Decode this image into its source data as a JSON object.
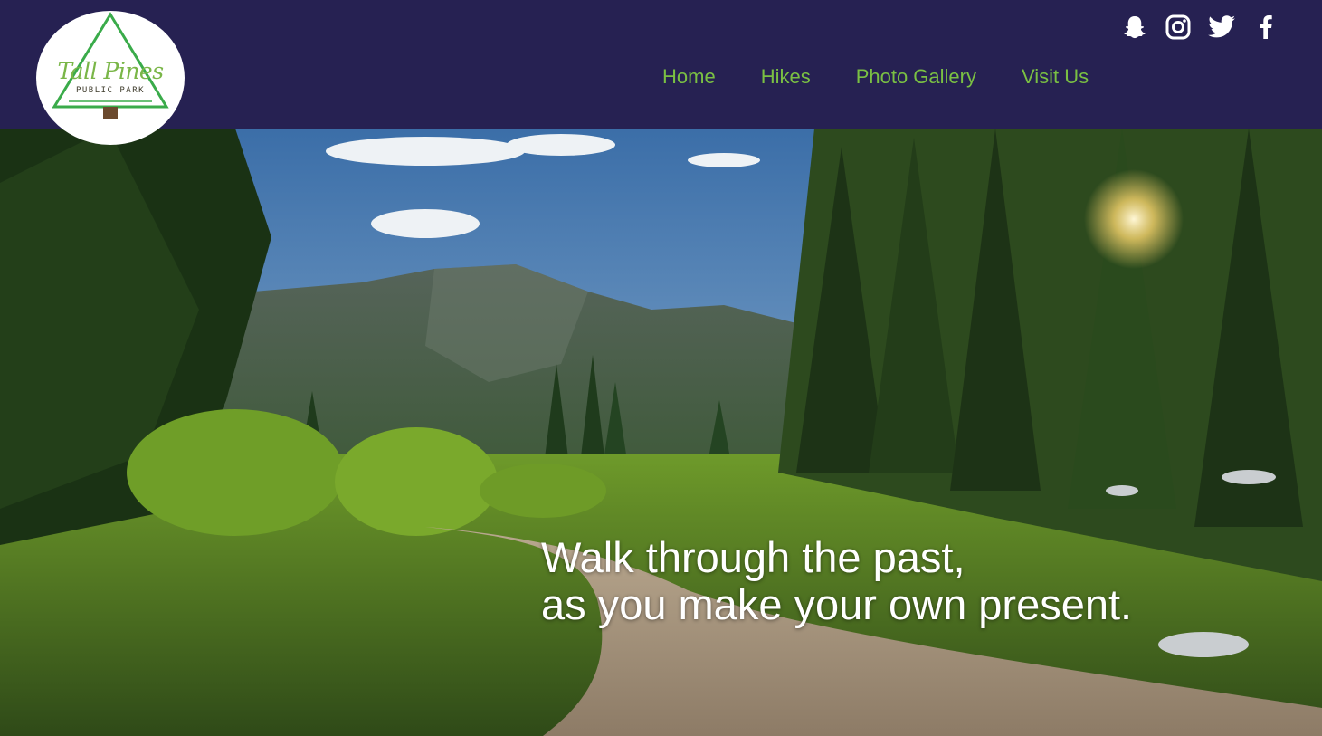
{
  "brand": {
    "name": "Tall Pines",
    "subtitle": "PUBLIC PARK"
  },
  "social": [
    {
      "icon": "snapchat-icon"
    },
    {
      "icon": "instagram-icon"
    },
    {
      "icon": "twitter-icon"
    },
    {
      "icon": "facebook-icon"
    }
  ],
  "nav": {
    "items": [
      {
        "label": "Home"
      },
      {
        "label": "Hikes"
      },
      {
        "label": "Photo Gallery"
      },
      {
        "label": "Visit Us"
      }
    ]
  },
  "hero": {
    "line1": "Walk through the past,",
    "line2": "as you make your own present."
  },
  "colors": {
    "header_bg": "#262152",
    "nav_text": "#7ac043",
    "logo_green": "#3aab4a",
    "hero_text": "#ffffff"
  }
}
